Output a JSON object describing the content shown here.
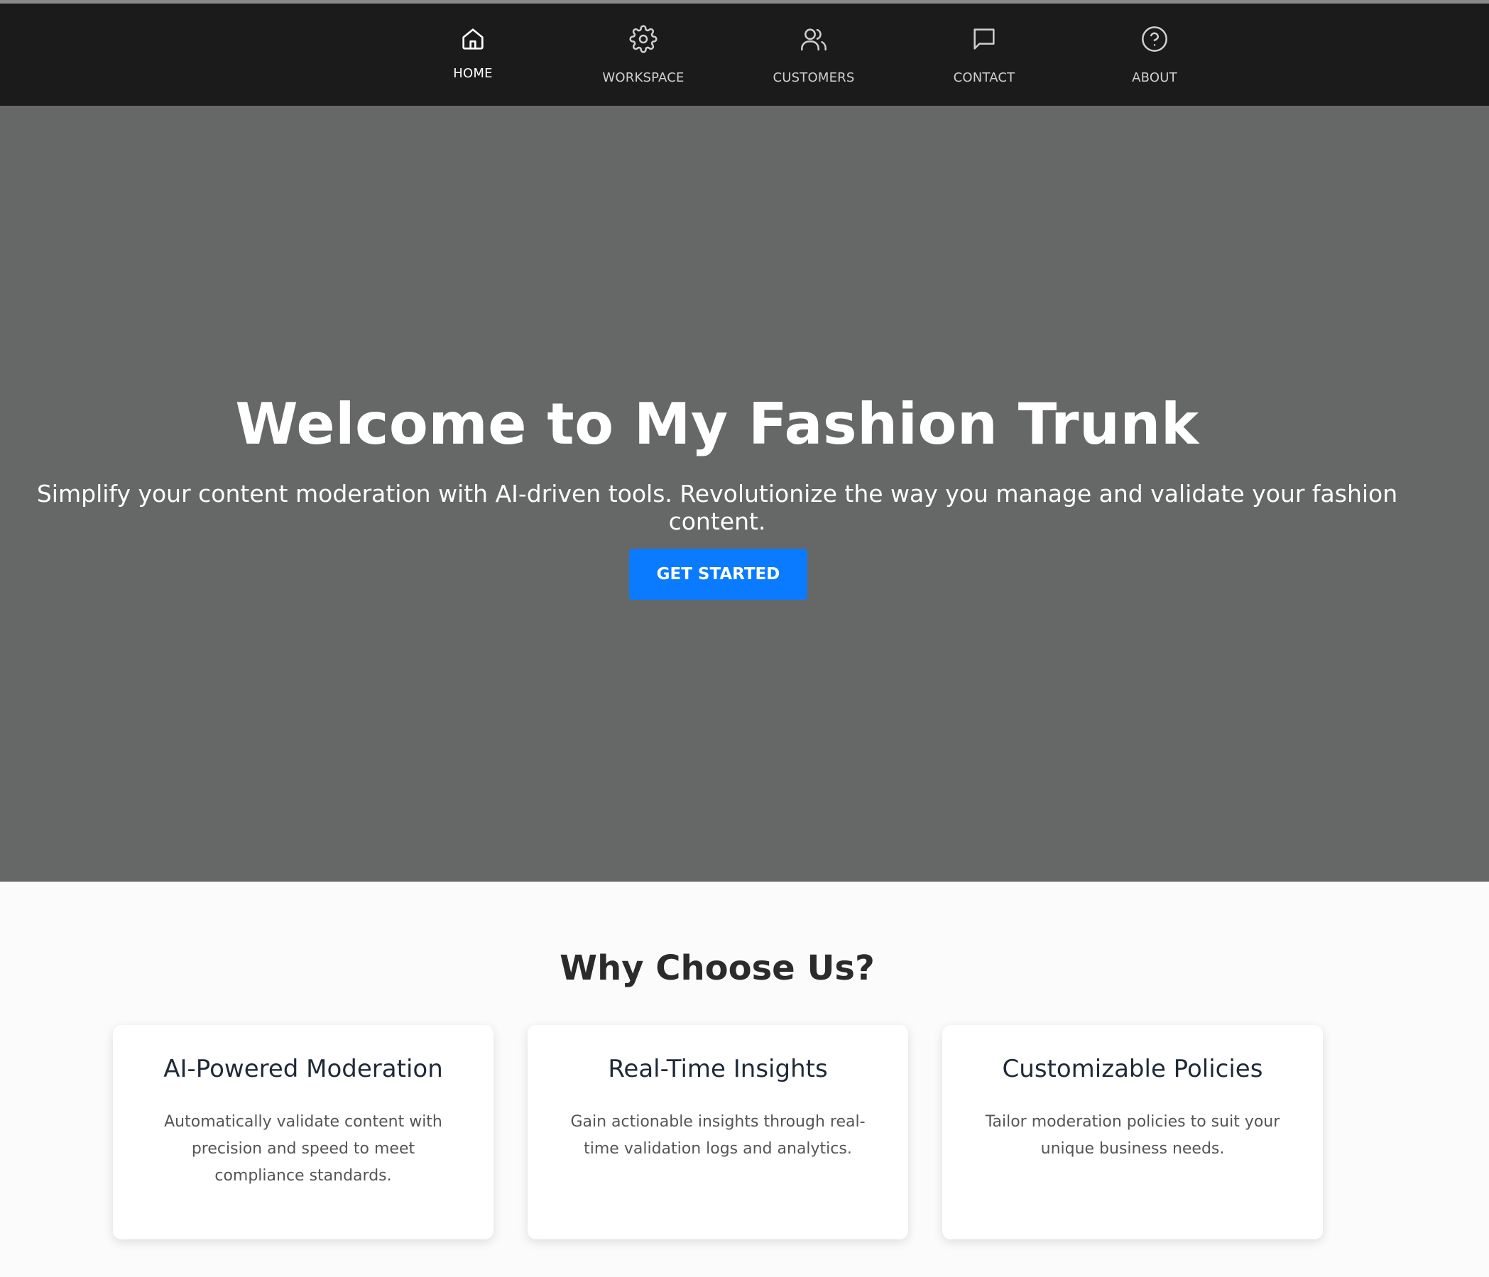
{
  "nav": {
    "items": [
      {
        "label": "HOME",
        "icon": "home-icon",
        "active": true
      },
      {
        "label": "WORKSPACE",
        "icon": "gear-icon",
        "active": false
      },
      {
        "label": "CUSTOMERS",
        "icon": "users-icon",
        "active": false
      },
      {
        "label": "CONTACT",
        "icon": "message-icon",
        "active": false
      },
      {
        "label": "ABOUT",
        "icon": "help-circle-icon",
        "active": false
      }
    ]
  },
  "hero": {
    "title": "Welcome to My Fashion Trunk",
    "subtitle": "Simplify your content moderation with AI-driven tools. Revolutionize the way you manage and validate your fashion content.",
    "cta_label": "GET STARTED"
  },
  "features": {
    "title": "Why Choose Us?",
    "cards": [
      {
        "title": "AI-Powered Moderation",
        "description": "Automatically validate content with precision and speed to meet compliance standards."
      },
      {
        "title": "Real-Time Insights",
        "description": "Gain actionable insights through real-time validation logs and analytics."
      },
      {
        "title": "Customizable Policies",
        "description": "Tailor moderation policies to suit your unique business needs."
      }
    ]
  },
  "colors": {
    "nav_background": "#1b1b1b",
    "hero_background": "#666767",
    "accent": "#0a7bff",
    "page_background": "#fbfbfb"
  }
}
